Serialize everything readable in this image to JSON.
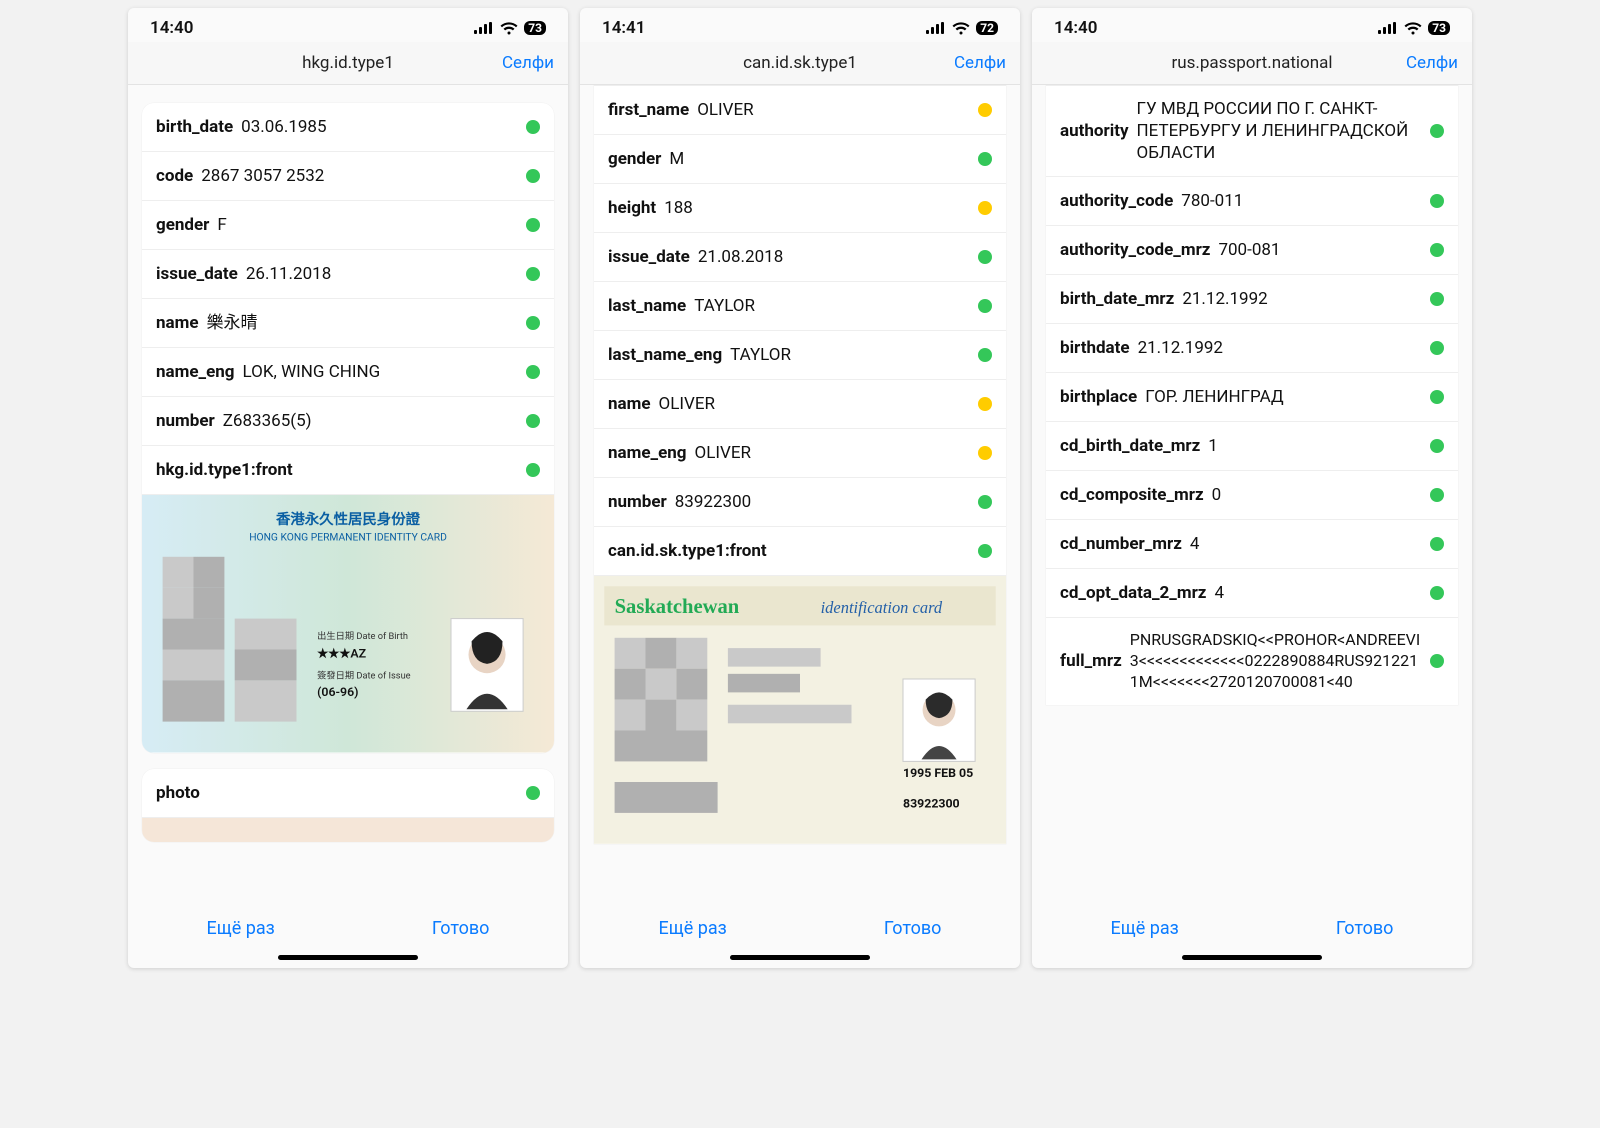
{
  "phones": [
    {
      "time": "14:40",
      "battery": "73",
      "title": "hkg.id.type1",
      "selfie": "Селфи",
      "again": "Ещё раз",
      "done": "Готово",
      "rows": [
        {
          "k": "birth_date",
          "v": "03.06.1985",
          "s": "g"
        },
        {
          "k": "code",
          "v": "2867 3057 2532",
          "s": "g"
        },
        {
          "k": "gender",
          "v": "F",
          "s": "g"
        },
        {
          "k": "issue_date",
          "v": "26.11.2018",
          "s": "g"
        },
        {
          "k": "name",
          "v": "樂永晴",
          "s": "g"
        },
        {
          "k": "name_eng",
          "v": "LOK, WING CHING",
          "s": "g"
        },
        {
          "k": "number",
          "v": "Z683365(5)",
          "s": "g"
        },
        {
          "k": "hkg.id.type1:front",
          "v": "",
          "s": "g"
        }
      ],
      "photo_label": "photo",
      "id_lines": {
        "t1": "香港永久性居民身份證",
        "t2": "HONG KONG PERMANENT IDENTITY CARD",
        "l1": "出生日期 Date of Birth",
        "l2": "★★★AZ",
        "l3": "簽發日期 Date of Issue",
        "l4": "(06-96)"
      }
    },
    {
      "time": "14:41",
      "battery": "72",
      "title": "can.id.sk.type1",
      "selfie": "Селфи",
      "again": "Ещё раз",
      "done": "Готово",
      "rows": [
        {
          "k": "first_name",
          "v": "OLIVER",
          "s": "y"
        },
        {
          "k": "gender",
          "v": "M",
          "s": "g"
        },
        {
          "k": "height",
          "v": "188",
          "s": "y"
        },
        {
          "k": "issue_date",
          "v": "21.08.2018",
          "s": "g"
        },
        {
          "k": "last_name",
          "v": "TAYLOR",
          "s": "g"
        },
        {
          "k": "last_name_eng",
          "v": "TAYLOR",
          "s": "g"
        },
        {
          "k": "name",
          "v": "OLIVER",
          "s": "y"
        },
        {
          "k": "name_eng",
          "v": "OLIVER",
          "s": "y"
        },
        {
          "k": "number",
          "v": "83922300",
          "s": "g"
        },
        {
          "k": "can.id.sk.type1:front",
          "v": "",
          "s": "g"
        }
      ],
      "id_lines": {
        "t1": "Saskatchewan",
        "t2": "identification card",
        "l1": "1995 FEB 05",
        "l2": "83922300"
      }
    },
    {
      "time": "14:40",
      "battery": "73",
      "title": "rus.passport.national",
      "selfie": "Селфи",
      "again": "Ещё раз",
      "done": "Готово",
      "rows": [
        {
          "k": "authority",
          "v": "ГУ МВД РОССИИ ПО Г. САНКТ-ПЕТЕРБУРГУ И ЛЕНИНГРАДСКОЙ ОБЛАСТИ",
          "s": "g"
        },
        {
          "k": "authority_code",
          "v": "780-011",
          "s": "g"
        },
        {
          "k": "authority_code_mrz",
          "v": "700-081",
          "s": "g"
        },
        {
          "k": "birth_date_mrz",
          "v": "21.12.1992",
          "s": "g"
        },
        {
          "k": "birthdate",
          "v": "21.12.1992",
          "s": "g"
        },
        {
          "k": "birthplace",
          "v": "ГОР. ЛЕНИНГРАД",
          "s": "g"
        },
        {
          "k": "cd_birth_date_mrz",
          "v": "1",
          "s": "g"
        },
        {
          "k": "cd_composite_mrz",
          "v": "0",
          "s": "g"
        },
        {
          "k": "cd_number_mrz",
          "v": "4",
          "s": "g"
        },
        {
          "k": "cd_opt_data_2_mrz",
          "v": "4",
          "s": "g"
        },
        {
          "k": "full_mrz",
          "v": "PNRUSGRADSKIQ<<PROHOR<ANDREEVI3<<<<<<<<<<<<<0222890884RUS9212211M<<<<<<<2720120700081<40",
          "s": "g"
        }
      ]
    }
  ]
}
